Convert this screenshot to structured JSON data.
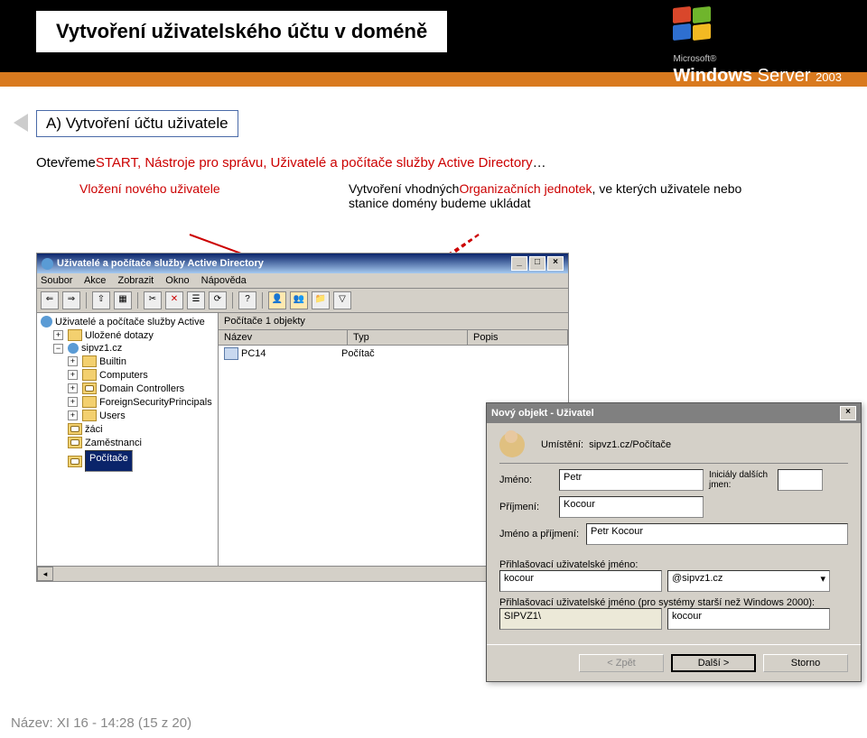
{
  "slide": {
    "title": "Vytvoření uživatelského účtu v doméně",
    "logo_ms": "Microsoft®",
    "logo_prod1": "Windows ",
    "logo_prod2": "Server",
    "logo_year": "2003",
    "section_a": "A) Vytvoření účtu uživatele",
    "instr1": "Otevřeme",
    "instr2": "START, Nástroje pro správu, Uživatelé a počítače služby Active Directory",
    "instr3": "…",
    "ann_left": "Vložení nového uživatele",
    "ann_right_1": "Vytvoření vhodných",
    "ann_right_2": "Organizačních jednotek",
    "ann_right_3": ", ve kterých uživatele nebo stanice domény budeme ukládat",
    "footer": "Název: XI 16 - 14:28 (15 z 20)"
  },
  "aduc": {
    "title": "Uživatelé a počítače služby Active Directory",
    "menu": [
      "Soubor",
      "Akce",
      "Zobrazit",
      "Okno",
      "Nápověda"
    ],
    "list_header": "Počítače  1 objekty",
    "cols": [
      "Název",
      "Typ",
      "Popis"
    ],
    "row": {
      "name": "PC14",
      "type": "Počítač",
      "desc": ""
    },
    "tree": {
      "root": "Uživatelé a počítače služby Active",
      "saved": "Uložené dotazy",
      "domain": "sipvz1.cz",
      "builtin": "Builtin",
      "computers": "Computers",
      "dc": "Domain Controllers",
      "fsp": "ForeignSecurityPrincipals",
      "users": "Users",
      "zaci": "žáci",
      "zam": "Zaměstnanci",
      "poc": "Počítače"
    }
  },
  "dlg": {
    "title": "Nový objekt - Uživatel",
    "loc_lbl": "Umístění:",
    "loc": "sipvz1.cz/Počítače",
    "jmeno_lbl": "Jméno:",
    "jmeno": "Petr",
    "init_lbl": "Iniciály dalších jmen:",
    "init": "",
    "prijm_lbl": "Příjmení:",
    "prijm": "Kocour",
    "full_lbl": "Jméno a příjmení:",
    "full": "Petr Kocour",
    "upn_lbl": "Přihlašovací uživatelské jméno:",
    "upn": "kocour",
    "upn_dom": "@sipvz1.cz",
    "sam_lbl": "Přihlašovací uživatelské jméno (pro systémy starší než Windows 2000):",
    "sam_dom": "SIPVZ1\\",
    "sam": "kocour",
    "back": "< Zpět",
    "next": "Další >",
    "cancel": "Storno"
  }
}
